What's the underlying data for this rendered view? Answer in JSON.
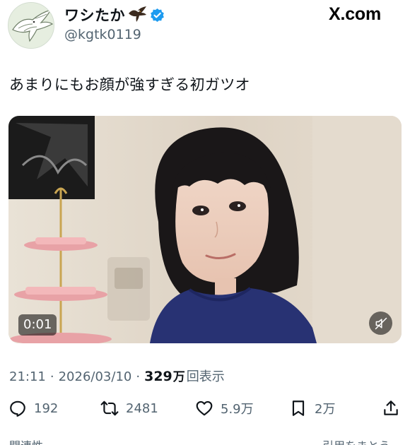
{
  "header": {
    "display_name": "ワシたか",
    "handle": "@kgtk0119",
    "brand": "X.com",
    "icons": [
      "avatar-eagle",
      "eagle-emoji-icon",
      "verified-badge-icon"
    ]
  },
  "tweet": {
    "text": "あまりにもお顔が強すぎる初ガツオ"
  },
  "media": {
    "duration": "0:01",
    "muted": true,
    "icons": [
      "mute-icon"
    ]
  },
  "meta": {
    "time": "21:11",
    "separator": "·",
    "date": "2026/03/10",
    "views_count": "329",
    "views_unit": "万",
    "views_label": "回表示"
  },
  "actions": {
    "reply": "192",
    "retweet": "2481",
    "like": "5.9万",
    "bookmark": "2万",
    "icons": [
      "reply-icon",
      "retweet-icon",
      "like-icon",
      "bookmark-icon",
      "share-icon"
    ]
  },
  "footer_cutoff": {
    "left": "関連性",
    "right": "引用をまとう..."
  },
  "colors": {
    "text_primary": "#0f1419",
    "text_secondary": "#536471",
    "verified_blue": "#1d9bf0"
  }
}
